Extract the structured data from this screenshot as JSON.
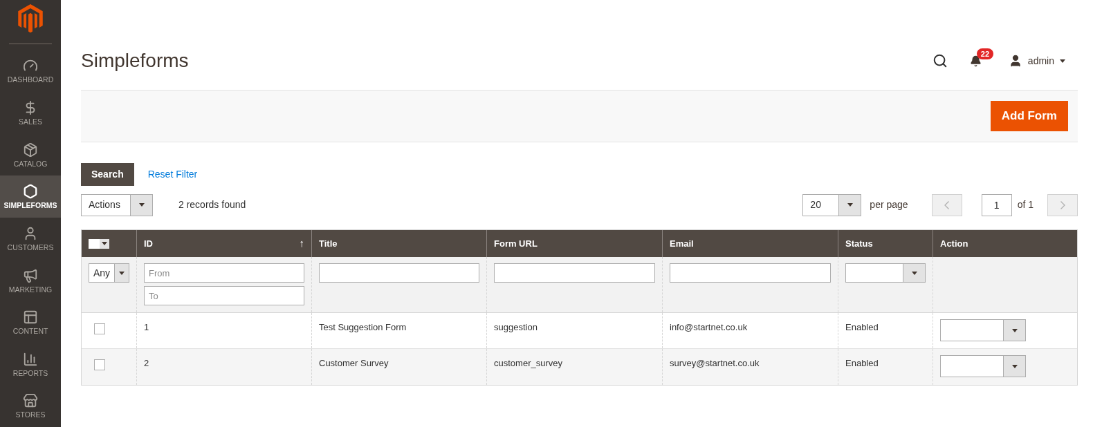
{
  "sidebar": {
    "items": [
      {
        "label": "DASHBOARD",
        "selected": false
      },
      {
        "label": "SALES",
        "selected": false
      },
      {
        "label": "CATALOG",
        "selected": false
      },
      {
        "label": "SIMPLEFORMS",
        "selected": true
      },
      {
        "label": "CUSTOMERS",
        "selected": false
      },
      {
        "label": "MARKETING",
        "selected": false
      },
      {
        "label": "CONTENT",
        "selected": false
      },
      {
        "label": "REPORTS",
        "selected": false
      },
      {
        "label": "STORES",
        "selected": false
      }
    ]
  },
  "header": {
    "title": "Simpleforms",
    "notifications": "22",
    "user": "admin"
  },
  "page_actions": {
    "add_button": "Add Form"
  },
  "filters": {
    "search_button": "Search",
    "reset_link": "Reset Filter"
  },
  "toolbar": {
    "actions": "Actions",
    "records": "2 records found",
    "per_page_value": "20",
    "per_page_label": "per page",
    "page": "1",
    "page_total": "of 1"
  },
  "table": {
    "mass_select": {
      "checked": false
    },
    "columns": [
      {
        "label": "ID",
        "sort_arrow": "↑"
      },
      {
        "label": "Title"
      },
      {
        "label": "Form URL"
      },
      {
        "label": "Email"
      },
      {
        "label": "Status"
      },
      {
        "label": "Action"
      }
    ],
    "filter_row": {
      "select_any": "Any",
      "id_from": {
        "placeholder": "From"
      },
      "id_to": {
        "placeholder": "To"
      }
    },
    "rows": [
      {
        "checked": false,
        "cells": [
          "1",
          "Test Suggestion Form",
          "suggestion",
          "info@startnet.co.uk",
          "Enabled"
        ]
      },
      {
        "checked": false,
        "cells": [
          "2",
          "Customer Survey",
          "customer_survey",
          "survey@startnet.co.uk",
          "Enabled"
        ]
      }
    ]
  }
}
